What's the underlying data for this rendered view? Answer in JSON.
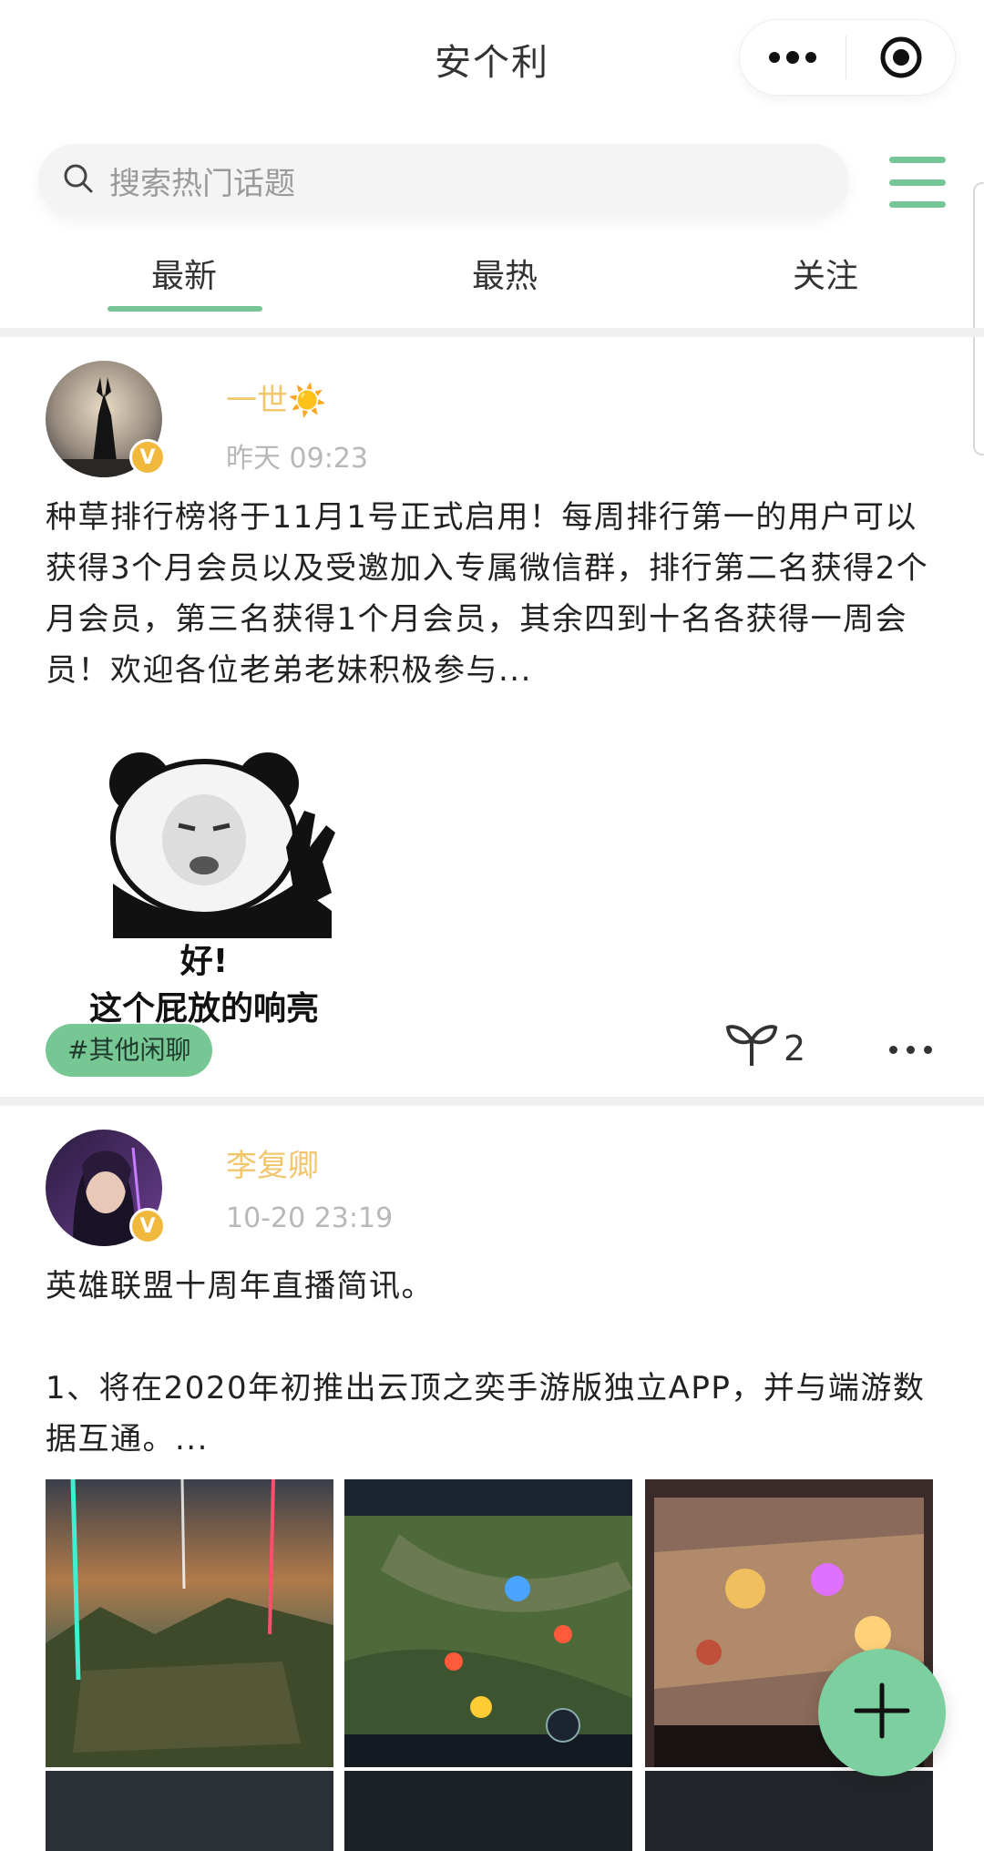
{
  "app": {
    "title": "安个利"
  },
  "search": {
    "placeholder": "搜索热门话题"
  },
  "tabs": [
    {
      "label": "最新",
      "active": true
    },
    {
      "label": "最热",
      "active": false
    },
    {
      "label": "关注",
      "active": false
    }
  ],
  "colors": {
    "accent": "#76c596",
    "username": "#f1c66d",
    "badge": "#f0b93e"
  },
  "posts": [
    {
      "user": "一世☀️",
      "time": "昨天 09:23",
      "verified": "V",
      "text": "种草排行榜将于11月1号正式启用！每周排行第一的用户可以获得3个月会员以及受邀加入专属微信群，排行第二名获得2个月会员，第三名获得1个月会员，其余四到十名各获得一周会员！欢迎各位老弟老妹积极参与...",
      "image_caption": [
        "好!",
        "这个屁放的响亮"
      ],
      "tag": "#其他闲聊",
      "likes": "2"
    },
    {
      "user": "李复卿",
      "time": "10-20 23:19",
      "verified": "V",
      "text_lines": [
        "英雄联盟十周年直播简讯。",
        "",
        "1、将在2020年初推出云顶之奕手游版独立APP，并与端游数据互通。..."
      ]
    }
  ],
  "icons": {
    "more": "more-dots-icon",
    "close": "target-close-icon",
    "search": "search-icon",
    "menu": "hamburger-menu-icon",
    "like": "sprout-icon",
    "add": "plus-icon"
  }
}
